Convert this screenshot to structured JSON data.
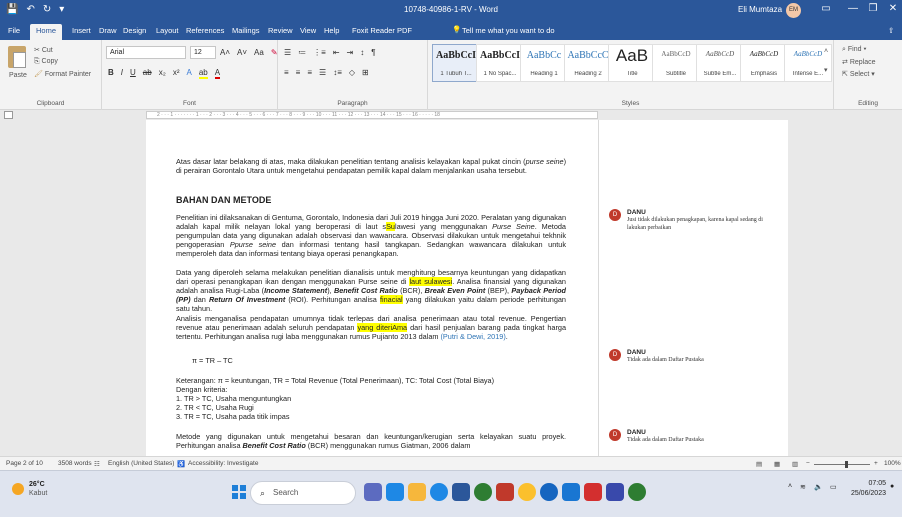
{
  "titlebar": {
    "doc_title": "10748-40986-1-RV - Word",
    "user_name": "Eli Mumtaza",
    "user_initials": "EM",
    "minimize": "—",
    "restore": "❐",
    "close": "✕"
  },
  "tabs": [
    "File",
    "Home",
    "Insert",
    "Draw",
    "Design",
    "Layout",
    "References",
    "Mailings",
    "Review",
    "View",
    "Help",
    "Foxit Reader PDF"
  ],
  "tell_me": "Tell me what you want to do",
  "ribbon": {
    "clipboard": {
      "paste": "Paste",
      "cut": "Cut",
      "copy": "Copy",
      "format_painter": "Format Painter",
      "label": "Clipboard"
    },
    "font": {
      "family": "Arial",
      "size": "12",
      "label": "Font"
    },
    "paragraph": {
      "label": "Paragraph"
    },
    "styles": {
      "label": "Styles",
      "items": [
        {
          "sample": "AaBbCcI",
          "name": "1 Tubuh T..."
        },
        {
          "sample": "AaBbCcI",
          "name": "1 No Spac..."
        },
        {
          "sample": "AaBbCc",
          "name": "Heading 1"
        },
        {
          "sample": "AaBbCcC",
          "name": "Heading 2"
        },
        {
          "sample": "AaB",
          "name": "Title"
        },
        {
          "sample": "AaBbCcD",
          "name": "Subtitle"
        },
        {
          "sample": "AaBbCcD",
          "name": "Subtle Em..."
        },
        {
          "sample": "AaBbCcD",
          "name": "Emphasis"
        },
        {
          "sample": "AaBbCcD",
          "name": "Intense E..."
        }
      ]
    },
    "editing": {
      "find": "Find",
      "replace": "Replace",
      "select": "Select",
      "label": "Editing"
    }
  },
  "ruler": "2 · · · 1 · · · · · · · 1 · · · 2 · · · 3 · · · 4 · · · 5 · · · 6 · · · 7 · · · 8 · · · 9 · · · 10 · · · 11 · · · 12 · · · 13 · · · 14 · · · 15 · · · 16 · · · · · 18",
  "document": {
    "intro_a": "Atas dasar latar belakang di atas, maka dilakukan penelitian tentang analisis kelayakan kapal pukat cincin (",
    "intro_b": "purse seine",
    "intro_c": ") di perairan Gorontalo Utara untuk mengetahui pendapatan pemilik kapal dalam menjalankan usaha tersebut.",
    "heading": "BAHAN DAN METODE",
    "p1_a": "Penelitian ini dilaksanakan di Gentuma, Gorontalo, Indonesia dari Juli 2019 hingga Juni 2020. Peralatan yang digunakan adalah kapal milik nelayan lokal yang beroperasi di laut s",
    "p1_hl1": "Su",
    "p1_b": "lawesi yang menggunakan ",
    "p1_c": "Purse Seine",
    "p1_d": ". Metoda pengumpulan data yang digunakan adalah observasi dan wawancara. Observasi dilakukan untuk mengetahui tekhnik pengoperasian ",
    "p1_e": "Ppurse seine",
    "p1_f": " dan informasi tentang hasil tangkapan. Sedangkan wawancara dilakukan untuk memperoleh data dan informasi tentang biaya operasi penangkapan.",
    "p2_a": "Data yang diperoleh selama melakukan penelitian dianalisis untuk menghitung besarnya keuntungan yang didapatkan dari operasi penangkapan ikan dengan menggunakan Purse seine di ",
    "p2_hl": "laut sulawesi",
    "p2_b": ". Analisa finansial yang digunakan adalah analisa Rugi-Laba (",
    "p2_c": "Income Statement",
    "p2_d": "), ",
    "p2_e": "Benefit Cost Ratio",
    "p2_f": " (BCR), ",
    "p2_g": "Break Even Point",
    "p2_h": " (BEP), ",
    "p2_i": "Payback Period (PP)",
    "p2_j": " dan ",
    "p2_k": "Return Of Investment",
    "p2_l": " (ROI). Perhitungan analisa ",
    "p2_hl2": "finacial",
    "p2_m": " yang dilakukan yaitu dalam periode perhitungan satu tahun.",
    "p3_a": "Analisis menganalisa pendapatan umumnya tidak terlepas dari analisa penerimaan atau total revenue. Pengertian revenue atau penerimaan adalah seluruh pendapatan ",
    "p3_hl": "yang diteriAma",
    "p3_b": " dari hasil penjualan barang pada tingkat harga tertentu. Perhitungan analisa rugi laba menggunakan rumus Pujianto 2013 dalam ",
    "p3_cite": "(Putri & Dewi, 2019)",
    "p3_c": ".",
    "formula": "π = TR – TC",
    "ket": "Keterangan: π = keuntungan, TR = Total Revenue (Total Penerimaan), TC: Total Cost (Total Biaya)",
    "criteria_label": "Dengan kriteria:",
    "criteria": [
      "1.   TR > TC, Usaha menguntungkan",
      "2.   TR < TC, Usaha Rugi",
      "3.   TR = TC, Usaha pada titik impas"
    ],
    "p4_a": "Metode yang digunakan untuk mengetahui besaran dan keuntungan/kerugian serta kelayakan suatu proyek. Perhitungan analisa ",
    "p4_b": "Benefit Cost Ratio",
    "p4_c": " (BCR) menggunakan rumus Giatman, 2006 dalam"
  },
  "comments": [
    {
      "initial": "D",
      "author": "DANU",
      "text": "Jusi tidak dilakukan penagkapan, karena kapal sedang di lakukan perbaikan"
    },
    {
      "initial": "D",
      "author": "DANU",
      "text": "Tidak ada dalam Daftar Pustaka"
    },
    {
      "initial": "D",
      "author": "DANU",
      "text": "Tidak ada dalam Daftar Pustaka"
    }
  ],
  "statusbar": {
    "page": "Page 2 of 10",
    "words": "3508 words",
    "language": "English (United States)",
    "accessibility": "Accessibility: Investigate",
    "zoom": "100%"
  },
  "taskbar": {
    "temp": "26°C",
    "weather": "Kabut",
    "search": "Search",
    "time": "07:05",
    "date": "25/06/2023"
  }
}
